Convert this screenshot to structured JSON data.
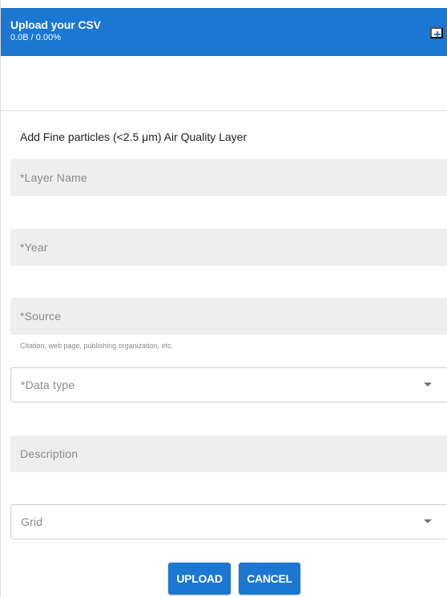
{
  "upload_header": {
    "title": "Upload your CSV",
    "progress": "0.0B / 0.00%",
    "add_icon": "plus-square-icon",
    "background_color": "#1b77d2"
  },
  "form": {
    "title": "Add Fine particles (<2.5 μm) Air Quality Layer",
    "layer_name_placeholder": "*Layer Name",
    "year_placeholder": "*Year",
    "source_placeholder": "*Source",
    "source_helper": "Citation, web page, publishing organization, etc.",
    "data_type_label": "*Data type",
    "description_placeholder": "Description",
    "grid_label": "Grid"
  },
  "actions": {
    "upload_label": "UPLOAD",
    "cancel_label": "CANCEL"
  }
}
